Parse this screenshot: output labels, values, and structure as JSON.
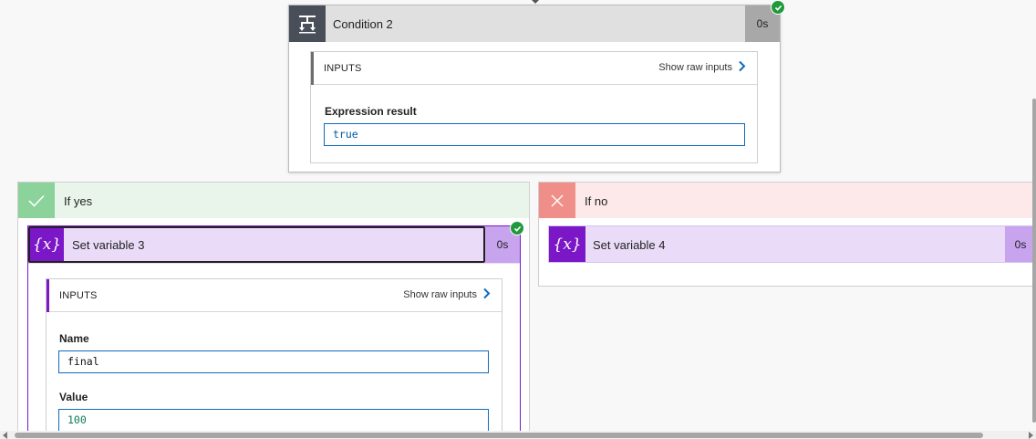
{
  "condition": {
    "title": "Condition 2",
    "duration": "0s",
    "inputs_label": "INPUTS",
    "raw_link": "Show raw inputs",
    "field_label": "Expression result",
    "field_value": "true"
  },
  "branch_yes": {
    "title": "If yes",
    "action": {
      "title": "Set variable 3",
      "duration": "0s",
      "icon_glyph": "{x}",
      "inputs_label": "INPUTS",
      "raw_link": "Show raw inputs",
      "fields": [
        {
          "label": "Name",
          "value": "final"
        },
        {
          "label": "Value",
          "value": "100"
        }
      ]
    }
  },
  "branch_no": {
    "title": "If no",
    "action": {
      "title": "Set variable 4",
      "duration": "0s",
      "icon_glyph": "{x}"
    }
  },
  "colors": {
    "accent_blue": "#0f6cbd",
    "success_green": "#1e9a3b",
    "yes_green": "#8bd39a",
    "no_red": "#f08f8a",
    "variable_purple": "#7b17c7",
    "condition_gray": "#484f58"
  },
  "icons": [
    "condition-icon",
    "check-icon",
    "close-icon",
    "variable-icon",
    "chevron-right-icon",
    "success-check-icon"
  ]
}
